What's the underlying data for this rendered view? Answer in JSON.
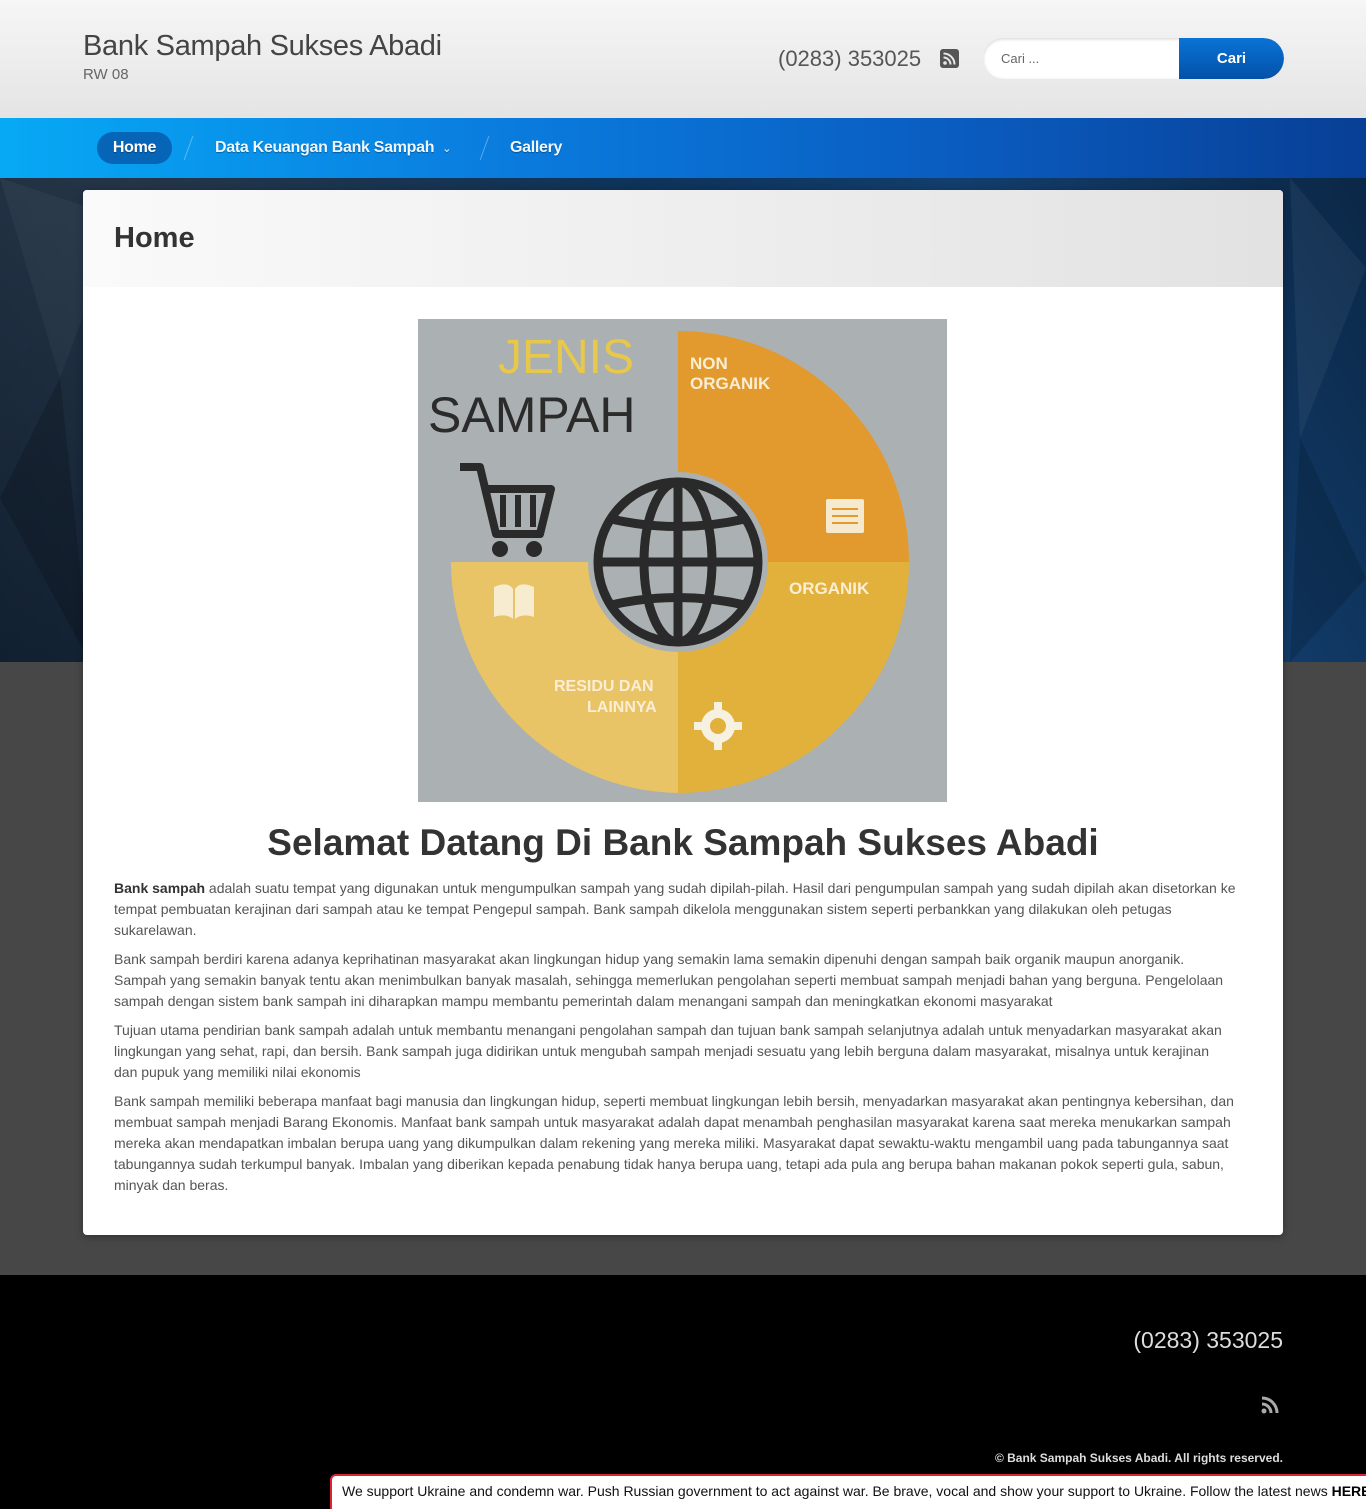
{
  "header": {
    "site_title": "Bank Sampah Sukses Abadi",
    "site_subtitle": "RW 08",
    "phone": "(0283) 353025",
    "rss_icon": "rss-icon",
    "search": {
      "placeholder": "Cari ...",
      "button_label": "Cari"
    }
  },
  "nav": {
    "items": [
      {
        "label": "Home",
        "active": true
      },
      {
        "label": "Data Keuangan Bank Sampah",
        "has_dropdown": true
      },
      {
        "label": "Gallery"
      }
    ],
    "dropdown_glyph": "⌄"
  },
  "content": {
    "page_title": "Home",
    "image": {
      "title_line1": "JENIS",
      "title_line2": "SAMPAH",
      "segments": [
        "NON",
        "ORGANIK",
        "ORGANIK",
        "RESIDU DAN",
        "LAINNYA"
      ],
      "icons": [
        "shopping-cart-icon",
        "globe-icon",
        "notepad-icon",
        "book-icon",
        "gear-icon"
      ]
    },
    "heading": "Selamat Datang Di Bank Sampah Sukses Abadi",
    "lead_bold": "Bank sampah",
    "paragraph_1_rest": " adalah suatu tempat yang digunakan untuk mengumpulkan sampah yang sudah dipilah-pilah. Hasil dari pengumpulan sampah yang sudah dipilah akan disetorkan ke tempat pembuatan kerajinan dari sampah atau ke tempat Pengepul sampah. Bank sampah dikelola menggunakan sistem seperti perbankkan yang dilakukan oleh petugas sukarelawan.",
    "paragraph_2": "Bank sampah berdiri karena adanya keprihatinan masyarakat akan lingkungan hidup yang semakin lama semakin dipenuhi dengan sampah baik organik maupun anorganik. Sampah yang semakin banyak tentu akan menimbulkan banyak masalah, sehingga memerlukan pengolahan seperti membuat sampah menjadi bahan yang berguna. Pengelolaan sampah dengan sistem bank sampah ini diharapkan mampu membantu pemerintah dalam menangani sampah dan meningkatkan ekonomi masyarakat",
    "paragraph_3": "Tujuan utama pendirian bank sampah adalah untuk membantu menangani pengolahan sampah dan tujuan bank sampah selanjutnya adalah untuk menyadarkan masyarakat akan lingkungan yang sehat, rapi, dan bersih. Bank sampah juga didirikan untuk mengubah sampah menjadi sesuatu yang lebih berguna dalam masyarakat, misalnya untuk kerajinan dan pupuk yang memiliki nilai ekonomis",
    "paragraph_4": "Bank sampah memiliki beberapa manfaat bagi manusia dan lingkungan hidup, seperti membuat lingkungan lebih bersih, menyadarkan masyarakat akan pentingnya kebersihan, dan membuat sampah menjadi Barang Ekonomis. Manfaat bank sampah untuk masyarakat adalah dapat menambah penghasilan masyarakat karena saat mereka menukarkan sampah mereka akan mendapatkan imbalan berupa uang yang dikumpulkan dalam rekening yang mereka miliki. Masyarakat dapat sewaktu-waktu mengambil uang pada tabungannya saat tabungannya sudah terkumpul banyak. Imbalan yang diberikan kepada penabung tidak hanya berupa uang, tetapi ada pula ang berupa bahan makanan pokok seperti gula, sabun, minyak dan beras."
  },
  "footer": {
    "phone": "(0283) 353025",
    "rss_icon": "rss-icon",
    "copyright": "© Bank Sampah Sukses Abadi. All rights reserved."
  },
  "notice": {
    "text": "We support Ukraine and condemn war. Push Russian government to act against war. Be brave, vocal and show your support to Ukraine. Follow the latest news ",
    "link": "HERE"
  },
  "colors": {
    "nav_start": "#07a9f5",
    "nav_end": "#083f95",
    "button": "#0351a8",
    "image_orange": "#e29a2e",
    "image_yellow": "#e2b13c",
    "image_pale_yellow": "#e9c466",
    "image_bg": "#abb0b2"
  }
}
